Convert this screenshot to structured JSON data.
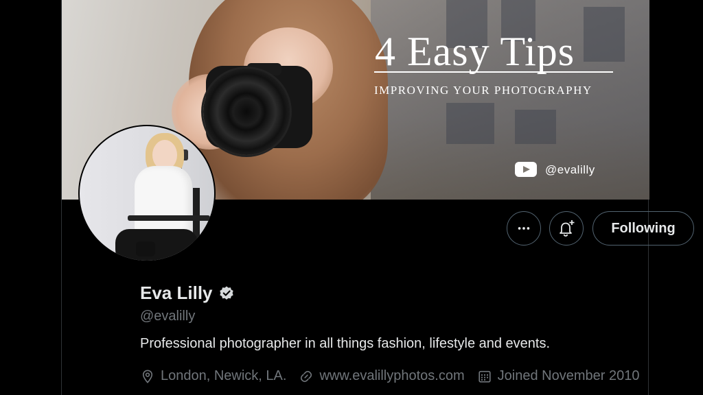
{
  "banner": {
    "title": "4 Easy Tips",
    "subtitle": "IMPROVING YOUR PHOTOGRAPHY",
    "handle": "@evalilly",
    "platform_icon": "youtube-icon"
  },
  "actions": {
    "more_icon": "more-icon",
    "notify_icon": "bell-plus-icon",
    "following_label": "Following"
  },
  "profile": {
    "display_name": "Eva Lilly",
    "verified_icon": "verified-badge-icon",
    "handle": "@evalilly",
    "bio": "Professional photographer in all things fashion, lifestyle and events.",
    "location": "London, Newick, LA.",
    "website": "www.evalillyphotos.com",
    "joined": "Joined November 2010"
  },
  "colors": {
    "background": "#000000",
    "primary_text": "#e7e9ea",
    "secondary_text": "#71767b",
    "button_border": "#536471"
  }
}
